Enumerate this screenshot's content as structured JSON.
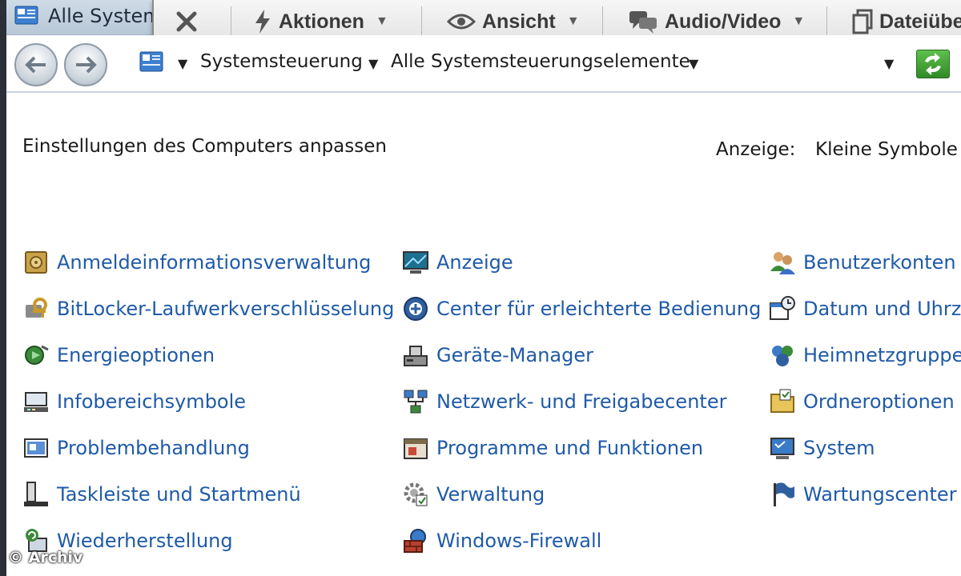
{
  "window": {
    "title": "Alle System"
  },
  "remote_toolbar": {
    "items": [
      {
        "label": "Aktionen",
        "icon": "lightning-icon"
      },
      {
        "label": "Ansicht",
        "icon": "eye-icon"
      },
      {
        "label": "Audio/Video",
        "icon": "chat-icon"
      },
      {
        "label": "Dateiübe",
        "icon": "document-icon"
      }
    ]
  },
  "address_bar": {
    "crumbs": [
      "Systemsteuerung",
      "Alle Systemsteuerungselemente"
    ]
  },
  "content": {
    "heading": "Einstellungen des Computers anpassen",
    "view_label": "Anzeige:",
    "view_value": "Kleine Symbole"
  },
  "items": {
    "col1": [
      {
        "label": "Anmeldeinformationsverwaltung",
        "icon": "credential-safe-icon"
      },
      {
        "label": "BitLocker-Laufwerkverschlüsselung",
        "icon": "bitlocker-key-icon"
      },
      {
        "label": "Energieoptionen",
        "icon": "power-options-icon"
      },
      {
        "label": "Infobereichsymbole",
        "icon": "notification-area-icon"
      },
      {
        "label": "Problembehandlung",
        "icon": "troubleshooting-icon"
      },
      {
        "label": "Taskleiste und Startmenü",
        "icon": "taskbar-icon"
      },
      {
        "label": "Wiederherstellung",
        "icon": "recovery-icon"
      }
    ],
    "col2": [
      {
        "label": "Anzeige",
        "icon": "display-monitor-icon"
      },
      {
        "label": "Center für erleichterte Bedienung",
        "icon": "ease-of-access-icon"
      },
      {
        "label": "Geräte-Manager",
        "icon": "device-manager-icon"
      },
      {
        "label": "Netzwerk- und Freigabecenter",
        "icon": "network-icon"
      },
      {
        "label": "Programme und Funktionen",
        "icon": "programs-icon"
      },
      {
        "label": "Verwaltung",
        "icon": "admin-tools-icon"
      },
      {
        "label": "Windows-Firewall",
        "icon": "firewall-icon"
      }
    ],
    "col3": [
      {
        "label": "Benutzerkonten",
        "icon": "user-accounts-icon"
      },
      {
        "label": "Datum und Uhrze",
        "icon": "date-time-icon"
      },
      {
        "label": "Heimnetzgruppe",
        "icon": "homegroup-icon"
      },
      {
        "label": "Ordneroptionen",
        "icon": "folder-options-icon"
      },
      {
        "label": "System",
        "icon": "system-icon"
      },
      {
        "label": "Wartungscenter",
        "icon": "action-center-flag-icon"
      }
    ]
  },
  "watermark": "© Archiv"
}
